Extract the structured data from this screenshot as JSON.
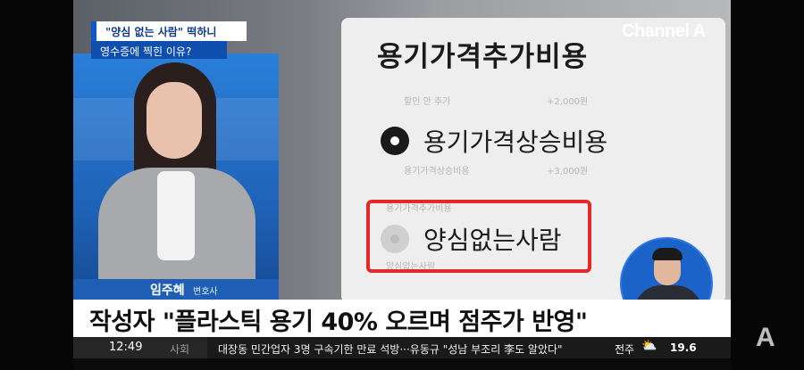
{
  "top_caption": {
    "line1": "\"양심 없는 사람\" 떡하니",
    "line2": "영수증에 찍힌 이유?"
  },
  "channel_logo": "Channel A",
  "screen": {
    "title": "용기가격추가비용",
    "option1": "용기가격상승비용",
    "option2": "양심없는사람",
    "faint_labels": [
      "할인 안 추가",
      "+2,000원",
      "용기가격상승비용",
      "+3,000원",
      "용기가격추가비용",
      "양심없는사람"
    ]
  },
  "name_tag": {
    "name": "임주혜",
    "role": "변호사"
  },
  "headline": "작성자 \"플라스틱 용기 40% 오르며 점주가 반영\"",
  "ticker": {
    "time": "12:49",
    "category": "사회",
    "news": "대장동 민간업자 3명 구속기한 만료 석방···유동규 \"성남 부조리 李도 알았다\"",
    "city": "전주",
    "weather_icon": "partly-cloudy-icon",
    "temperature": "19.6"
  },
  "side_mark": "A",
  "colors": {
    "accent_blue": "#1e5fb5",
    "highlight_red": "#e42727",
    "studio_blue": "#2a7fd8"
  }
}
